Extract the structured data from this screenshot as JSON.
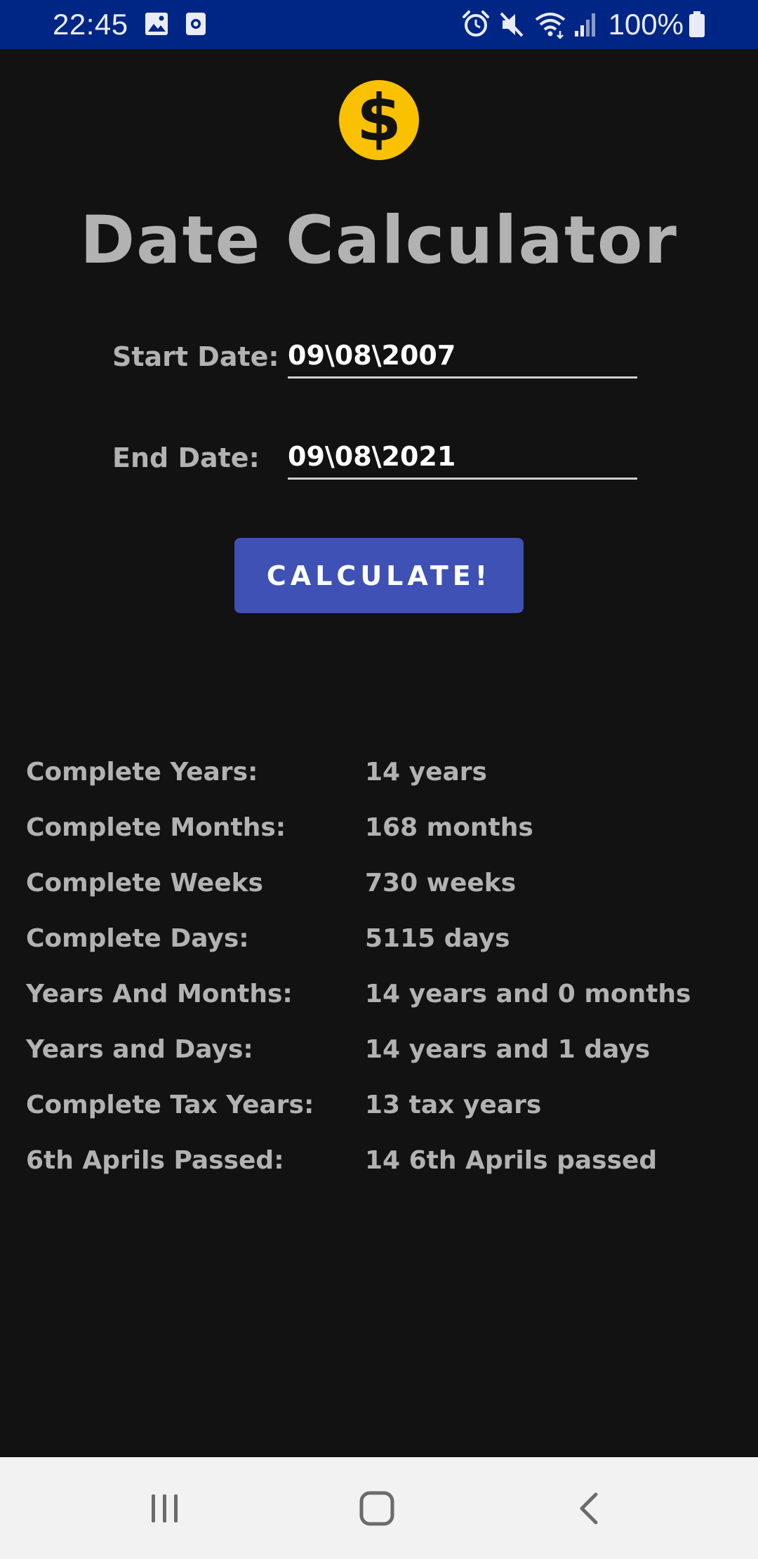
{
  "status_bar": {
    "time": "22:45",
    "battery": "100%",
    "left_icons": [
      "image-icon",
      "screenshot-icon"
    ],
    "right_icons": [
      "alarm-icon",
      "mute-icon",
      "wifi-icon",
      "signal-icon",
      "battery-icon"
    ]
  },
  "header": {
    "logo_symbol": "$",
    "logo_color": "#f9c100",
    "title": "Date Calculator"
  },
  "form": {
    "start_label": "Start Date:",
    "start_value": "09\\08\\2007",
    "end_label": "End Date:",
    "end_value": "09\\08\\2021",
    "calculate_label": "CALCULATE!",
    "button_color": "#3f51b5"
  },
  "results": [
    {
      "label": "Complete Years:",
      "value": "14 years"
    },
    {
      "label": "Complete Months:",
      "value": "168 months"
    },
    {
      "label": "Complete Weeks",
      "value": "730 weeks"
    },
    {
      "label": "Complete Days:",
      "value": "5115 days"
    },
    {
      "label": "Years And Months:",
      "value": "14 years and 0 months"
    },
    {
      "label": "Years and Days:",
      "value": "14 years and 1 days"
    },
    {
      "label": "Complete Tax Years:",
      "value": "13 tax years"
    },
    {
      "label": "6th Aprils Passed:",
      "value": "14 6th Aprils passed"
    }
  ],
  "nav_bar": {
    "buttons": [
      "recent-apps-icon",
      "home-icon",
      "back-icon"
    ]
  }
}
